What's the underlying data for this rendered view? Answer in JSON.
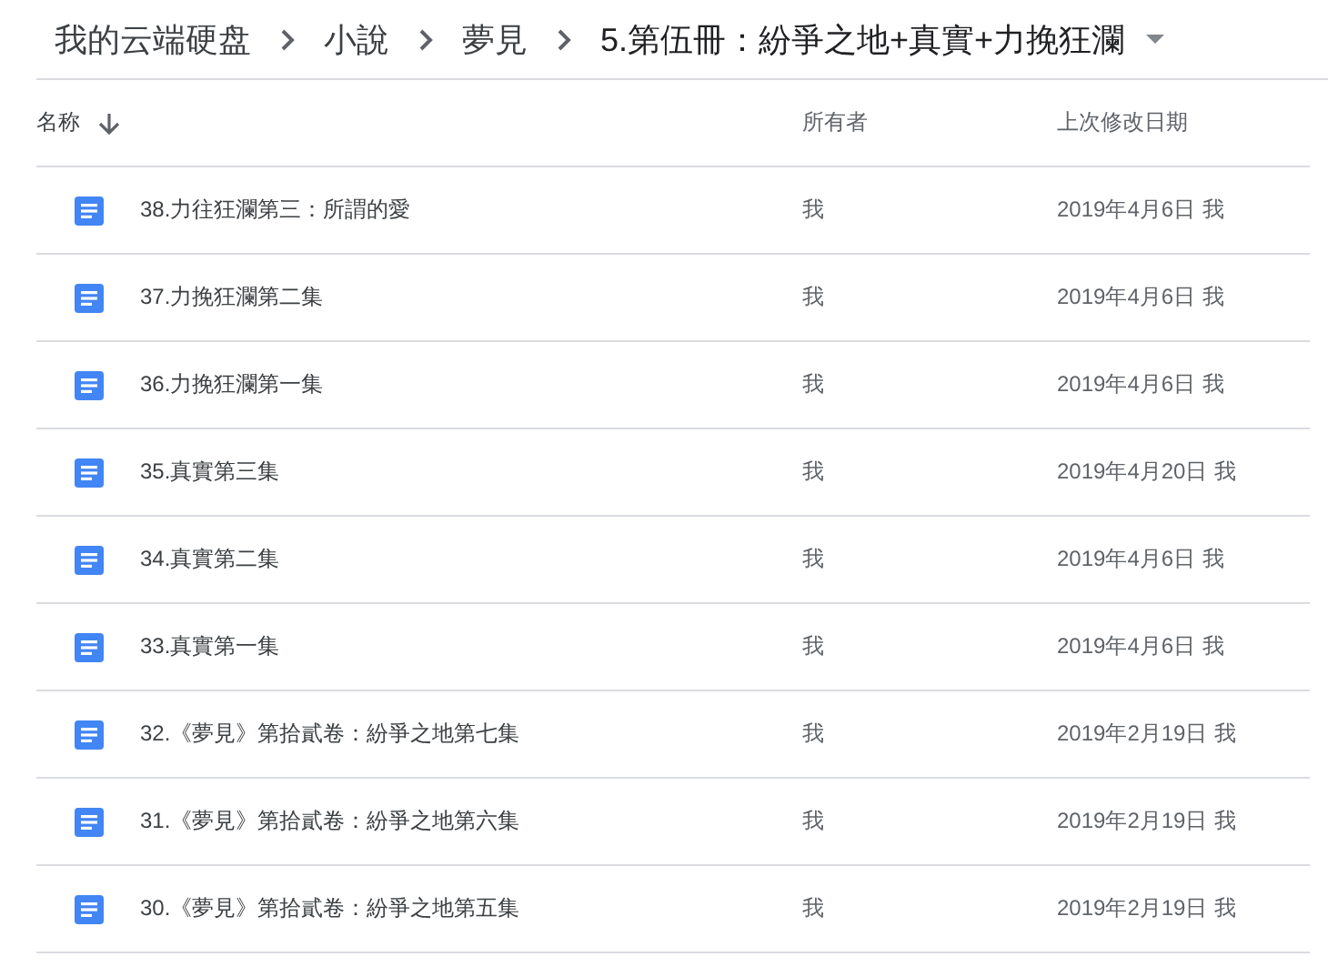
{
  "breadcrumb": [
    {
      "label": "我的云端硬盘"
    },
    {
      "label": "小說"
    },
    {
      "label": "夢見"
    },
    {
      "label": "5.第伍冊：紛爭之地+真實+力挽狂瀾",
      "current": true
    }
  ],
  "table": {
    "columns": [
      {
        "label": "名称",
        "sorted": true
      },
      {
        "label": "所有者",
        "sorted": false
      },
      {
        "label": "上次修改日期",
        "sorted": false
      }
    ],
    "rows": [
      {
        "name": "38.力往狂瀾第三：所謂的愛",
        "owner": "我",
        "modified": "2019年4月6日",
        "modified_by": "我"
      },
      {
        "name": "37.力挽狂瀾第二集",
        "owner": "我",
        "modified": "2019年4月6日",
        "modified_by": "我"
      },
      {
        "name": "36.力挽狂瀾第一集",
        "owner": "我",
        "modified": "2019年4月6日",
        "modified_by": "我"
      },
      {
        "name": "35.真實第三集",
        "owner": "我",
        "modified": "2019年4月20日",
        "modified_by": "我"
      },
      {
        "name": "34.真實第二集",
        "owner": "我",
        "modified": "2019年4月6日",
        "modified_by": "我"
      },
      {
        "name": "33.真實第一集",
        "owner": "我",
        "modified": "2019年4月6日",
        "modified_by": "我"
      },
      {
        "name": "32.《夢見》第拾貳卷：紛爭之地第七集",
        "owner": "我",
        "modified": "2019年2月19日",
        "modified_by": "我"
      },
      {
        "name": "31.《夢見》第拾貳卷：紛爭之地第六集",
        "owner": "我",
        "modified": "2019年2月19日",
        "modified_by": "我"
      },
      {
        "name": "30.《夢見》第拾貳卷：紛爭之地第五集",
        "owner": "我",
        "modified": "2019年2月19日",
        "modified_by": "我"
      }
    ]
  }
}
